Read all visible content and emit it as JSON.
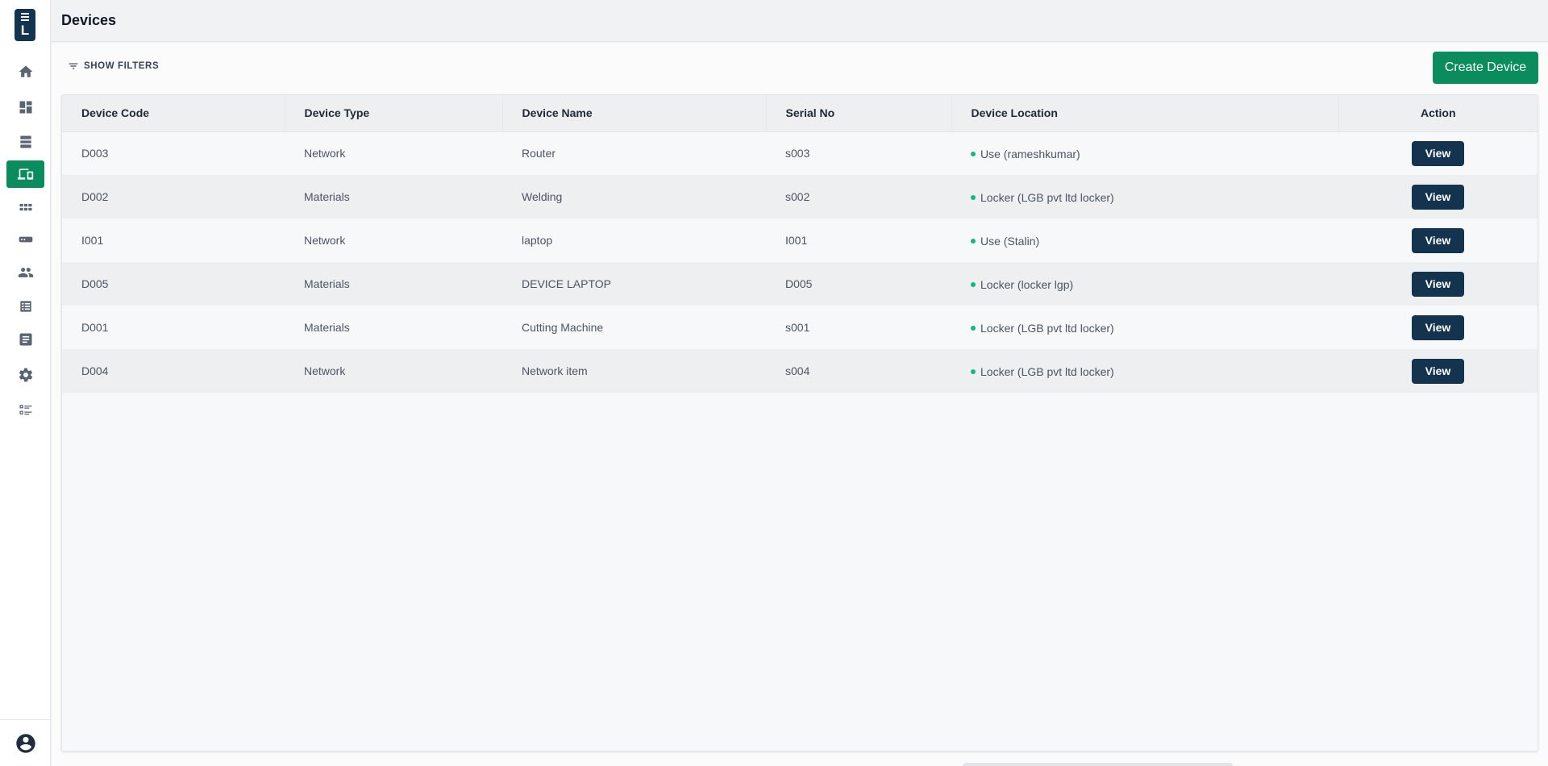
{
  "app": {
    "logo_letter": "L"
  },
  "sidebar": {
    "items": [
      {
        "icon": "home-icon",
        "active": false
      },
      {
        "icon": "dashboard-icon",
        "active": false
      },
      {
        "icon": "storage-icon",
        "active": false
      },
      {
        "icon": "devices-icon",
        "active": true
      },
      {
        "icon": "apps-grid-icon",
        "active": false
      },
      {
        "icon": "card-icon",
        "active": false
      },
      {
        "icon": "users-icon",
        "active": false
      },
      {
        "icon": "table-list-icon",
        "active": false
      },
      {
        "icon": "document-icon",
        "active": false
      },
      {
        "icon": "settings-icon",
        "active": false
      },
      {
        "icon": "checklist-icon",
        "active": false
      }
    ],
    "bottom_icon": "account-circle-icon"
  },
  "header": {
    "title": "Devices"
  },
  "toolbar": {
    "filters_label": "SHOW FILTERS",
    "create_label": "Create Device"
  },
  "table": {
    "columns": [
      "Device Code",
      "Device Type",
      "Device Name",
      "Serial No",
      "Device Location",
      "Action"
    ],
    "rows": [
      {
        "code": "D003",
        "type": "Network",
        "name": "Router",
        "serial": "s003",
        "location": "Use (rameshkumar)",
        "action": "View"
      },
      {
        "code": "D002",
        "type": "Materials",
        "name": "Welding",
        "serial": "s002",
        "location": "Locker (LGB pvt ltd locker)",
        "action": "View"
      },
      {
        "code": "I001",
        "type": "Network",
        "name": "laptop",
        "serial": "I001",
        "location": "Use (Stalin)",
        "action": "View"
      },
      {
        "code": "D005",
        "type": "Materials",
        "name": "DEVICE LAPTOP",
        "serial": "D005",
        "location": "Locker (locker lgp)",
        "action": "View"
      },
      {
        "code": "D001",
        "type": "Materials",
        "name": "Cutting Machine",
        "serial": "s001",
        "location": "Locker (LGB pvt ltd locker)",
        "action": "View"
      },
      {
        "code": "D004",
        "type": "Network",
        "name": "Network item",
        "serial": "s004",
        "location": "Locker (LGB pvt ltd locker)",
        "action": "View"
      }
    ]
  },
  "colors": {
    "accent": "#0a8c5e",
    "primary_dark": "#13334f",
    "status_dot": "#10b981"
  }
}
